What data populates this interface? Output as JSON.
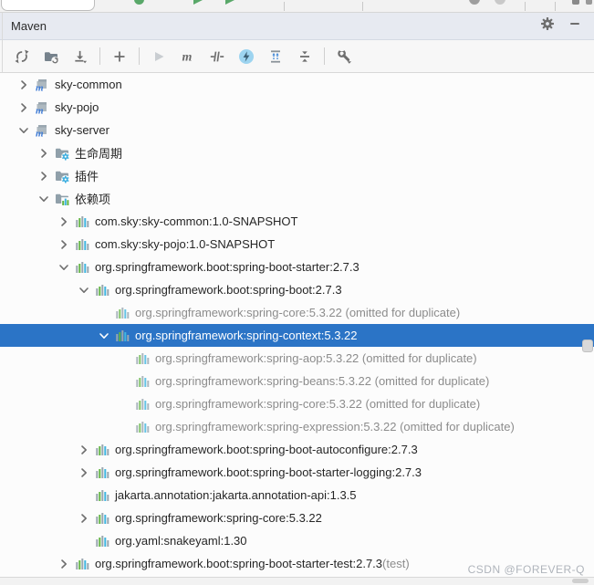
{
  "header": {
    "title": "Maven",
    "buttons": [
      {
        "name": "tool-window-settings-button",
        "icon": "gear-icon"
      },
      {
        "name": "hide-tool-window-button",
        "icon": "minimize-icon"
      }
    ]
  },
  "toolbar": {
    "buttons": [
      {
        "name": "reload-all-maven-projects-button",
        "icon": "reload-icon"
      },
      {
        "name": "generate-sources-button",
        "icon": "folder-sync-icon"
      },
      {
        "name": "download-sources-button",
        "icon": "download-icon"
      },
      {
        "type": "separator"
      },
      {
        "name": "add-maven-project-button",
        "icon": "plus-icon"
      },
      {
        "type": "separator"
      },
      {
        "name": "run-build-button",
        "icon": "run-icon",
        "disabled": true
      },
      {
        "name": "execute-maven-goal-button",
        "icon": "maven-goal-icon"
      },
      {
        "name": "skip-tests-button",
        "icon": "skip-tests-icon"
      },
      {
        "name": "offline-mode-button",
        "icon": "offline-lightning-icon",
        "active": true
      },
      {
        "name": "expand-all-button",
        "icon": "expand-all-icon"
      },
      {
        "name": "collapse-all-button",
        "icon": "collapse-all-icon"
      },
      {
        "type": "separator"
      },
      {
        "name": "maven-settings-button",
        "icon": "wrench-icon"
      }
    ]
  },
  "tree": {
    "rows": [
      {
        "level": 0,
        "chevron": "collapsed",
        "icon": "maven-module-icon",
        "label": "sky-common"
      },
      {
        "level": 0,
        "chevron": "collapsed",
        "icon": "maven-module-icon",
        "label": "sky-pojo"
      },
      {
        "level": 0,
        "chevron": "expanded",
        "icon": "maven-module-icon",
        "label": "sky-server"
      },
      {
        "level": 1,
        "chevron": "collapsed",
        "icon": "lifecycle-folder-icon",
        "label": "生命周期"
      },
      {
        "level": 1,
        "chevron": "collapsed",
        "icon": "plugins-folder-icon",
        "label": "插件"
      },
      {
        "level": 1,
        "chevron": "expanded",
        "icon": "dependencies-folder-icon",
        "label": "依赖项"
      },
      {
        "level": 2,
        "chevron": "collapsed",
        "icon": "library-icon",
        "label": "com.sky:sky-common:1.0-SNAPSHOT"
      },
      {
        "level": 2,
        "chevron": "collapsed",
        "icon": "library-icon",
        "label": "com.sky:sky-pojo:1.0-SNAPSHOT"
      },
      {
        "level": 2,
        "chevron": "expanded",
        "icon": "library-icon",
        "label": "org.springframework.boot:spring-boot-starter:2.7.3"
      },
      {
        "level": 3,
        "chevron": "expanded",
        "icon": "library-icon",
        "label": "org.springframework.boot:spring-boot:2.7.3"
      },
      {
        "level": 4,
        "chevron": "none",
        "icon": "library-icon",
        "label": "org.springframework:spring-core:5.3.22 (omitted for duplicate)",
        "grayed": true
      },
      {
        "level": 4,
        "chevron": "expanded",
        "icon": "library-icon",
        "label": "org.springframework:spring-context:5.3.22",
        "selected": true
      },
      {
        "level": 5,
        "chevron": "none",
        "icon": "library-icon",
        "label": "org.springframework:spring-aop:5.3.22 (omitted for duplicate)",
        "grayed": true
      },
      {
        "level": 5,
        "chevron": "none",
        "icon": "library-icon",
        "label": "org.springframework:spring-beans:5.3.22 (omitted for duplicate)",
        "grayed": true
      },
      {
        "level": 5,
        "chevron": "none",
        "icon": "library-icon",
        "label": "org.springframework:spring-core:5.3.22 (omitted for duplicate)",
        "grayed": true
      },
      {
        "level": 5,
        "chevron": "none",
        "icon": "library-icon",
        "label": "org.springframework:spring-expression:5.3.22 (omitted for duplicate)",
        "grayed": true
      },
      {
        "level": 3,
        "chevron": "collapsed",
        "icon": "library-icon",
        "label": "org.springframework.boot:spring-boot-autoconfigure:2.7.3"
      },
      {
        "level": 3,
        "chevron": "collapsed",
        "icon": "library-icon",
        "label": "org.springframework.boot:spring-boot-starter-logging:2.7.3"
      },
      {
        "level": 3,
        "chevron": "none",
        "icon": "library-icon",
        "label": "jakarta.annotation:jakarta.annotation-api:1.3.5"
      },
      {
        "level": 3,
        "chevron": "collapsed",
        "icon": "library-icon",
        "label": "org.springframework:spring-core:5.3.22"
      },
      {
        "level": 3,
        "chevron": "none",
        "icon": "library-icon",
        "label": "org.yaml:snakeyaml:1.30"
      },
      {
        "level": 2,
        "chevron": "collapsed",
        "icon": "library-icon",
        "label": "org.springframework.boot:spring-boot-starter-test:2.7.3",
        "suffix": " (test)"
      }
    ]
  },
  "watermark": "CSDN @FOREVER-Q",
  "colors": {
    "selection": "#2B74C6",
    "header_bg": "#E7EAF1",
    "toolbar_bg": "#F7F7F7",
    "tree_bg": "#FCFCFC",
    "grayed_text": "#8C8C8C",
    "library_bar_gray": "#9AA7B0",
    "library_bar_green": "#62B543",
    "library_bar_blue": "#40B6E0",
    "offline_active_bg": "#9DD4F0",
    "maven_m_blue": "#3E7BD6"
  }
}
